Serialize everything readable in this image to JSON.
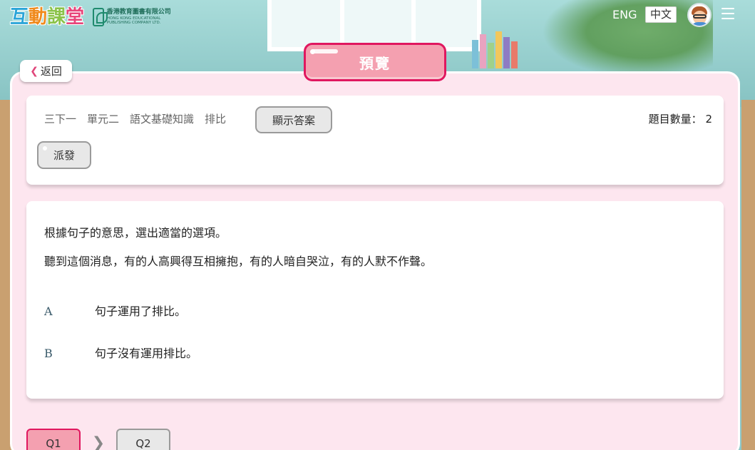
{
  "header": {
    "logo_chars": [
      {
        "char": "互",
        "color": "#2ba5d8"
      },
      {
        "char": "動",
        "color": "#f08a1c"
      },
      {
        "char": "課",
        "color": "#8bc34a"
      },
      {
        "char": "堂",
        "color": "#e8457a"
      }
    ],
    "publisher_zh": "香港教育圖書有限公司",
    "publisher_en": "HONG KONG EDUCATIONAL PUBLISHING COMPANY LTD.",
    "lang_eng": "ENG",
    "lang_zh": "中文",
    "avatar_icon": "teacher-avatar-icon",
    "menu_icon": "hamburger-menu-icon"
  },
  "back": {
    "icon": "chevron-left-icon",
    "label": "返回"
  },
  "page_title": "預覽",
  "info": {
    "crumbs": [
      "三下一",
      "單元二",
      "語文基礎知識",
      "排比"
    ],
    "show_answer": "顯示答案",
    "question_count_label": "題目數量：",
    "question_count": "2",
    "dispatch": "派發"
  },
  "question": {
    "prompt": "根據句子的意思，選出適當的選項。",
    "sentence": "聽到這個消息，有的人高興得互相擁抱，有的人暗自哭泣，有的人默不作聲。",
    "options": [
      {
        "letter": "A",
        "text": "句子運用了排比。"
      },
      {
        "letter": "B",
        "text": "句子沒有運用排比。"
      }
    ]
  },
  "nav": {
    "questions": [
      {
        "label": "Q1",
        "active": true
      },
      {
        "label": "Q2",
        "active": false
      }
    ],
    "arrow_icon": "chevron-right-icon"
  },
  "colors": {
    "accent_pink": "#e0175f",
    "panel_bg": "#fde6ef",
    "badge_fill": "#f4a0b0"
  }
}
